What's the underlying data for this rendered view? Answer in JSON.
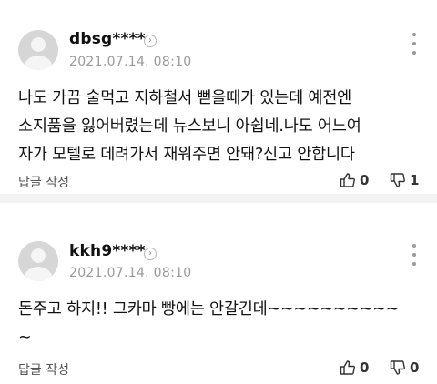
{
  "comments": [
    {
      "username": "dbsg****",
      "timestamp": "2021.07.14. 08:10",
      "lines": [
        "나도 가끔 술먹고 지하철서 뻗을때가 있는데 예전엔",
        "소지품을 잃어버렸는데 뉴스보니 아쉽네.나도 어느여",
        "자가 모텔로 데려가서 재워주면 안돼?신고 안합니다"
      ],
      "reply_label": "답글 작성",
      "likes": "0",
      "dislikes": "1"
    },
    {
      "username": "kkh9****",
      "timestamp": "2021.07.14. 08:10",
      "lines": [
        "돈주고 하지!! 그카마 빵에는 안갈긴데~~~~~~~~~~",
        "~"
      ],
      "reply_label": "답글 작성",
      "likes": "0",
      "dislikes": "0"
    }
  ],
  "icons": {
    "profile_arrow": "chevron-right-icon",
    "more": "more-vertical-icon",
    "like": "thumbs-up-icon",
    "dislike": "thumbs-down-icon"
  }
}
